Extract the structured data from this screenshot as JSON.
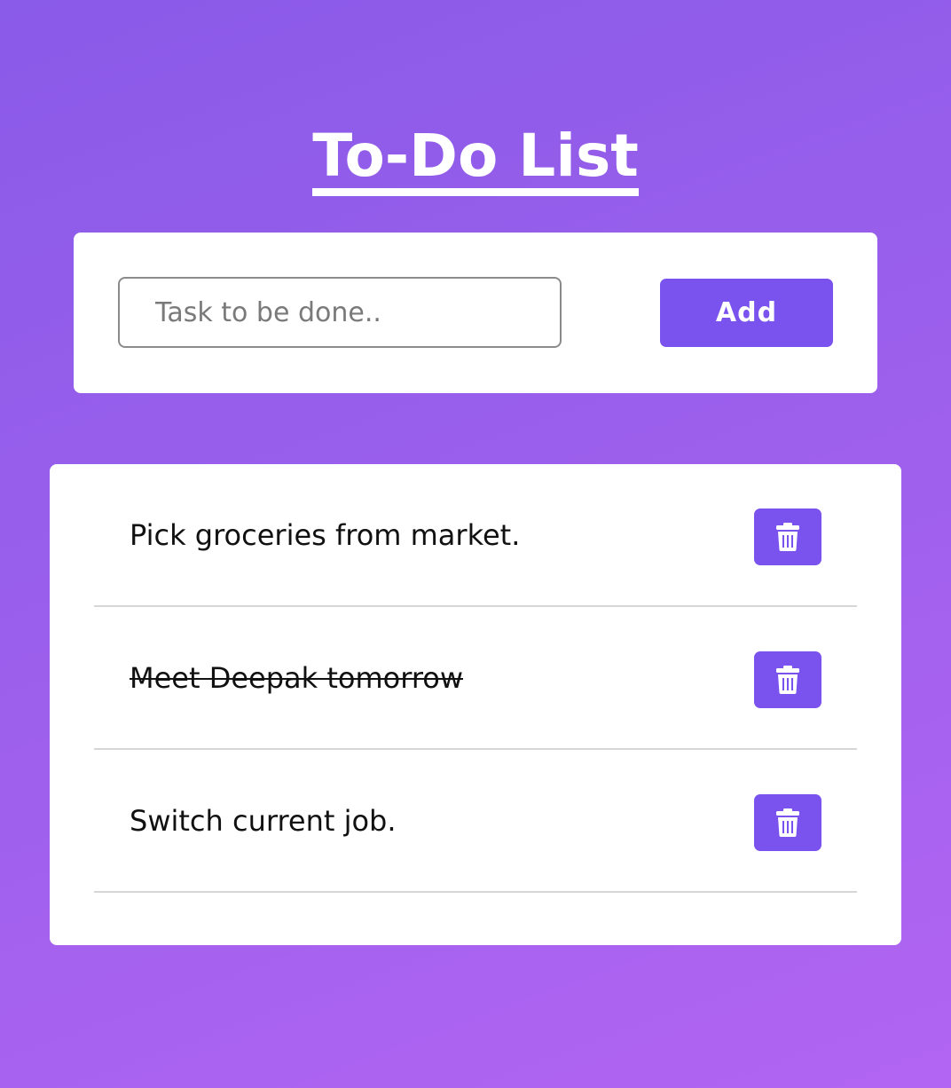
{
  "header": {
    "title": "To-Do List"
  },
  "form": {
    "input_value": "",
    "input_placeholder": "Task to be done..",
    "add_label": "Add"
  },
  "tasks": [
    {
      "text": "Pick groceries from market.",
      "completed": false
    },
    {
      "text": "Meet Deepak tomorrow",
      "completed": true
    },
    {
      "text": "Switch current job.",
      "completed": false
    }
  ],
  "icons": {
    "delete": "trash-icon"
  },
  "colors": {
    "accent": "#7a53ef",
    "background_start": "#8a5ae8",
    "background_end": "#b265f2",
    "card": "#ffffff",
    "divider": "#d6d6d6"
  }
}
